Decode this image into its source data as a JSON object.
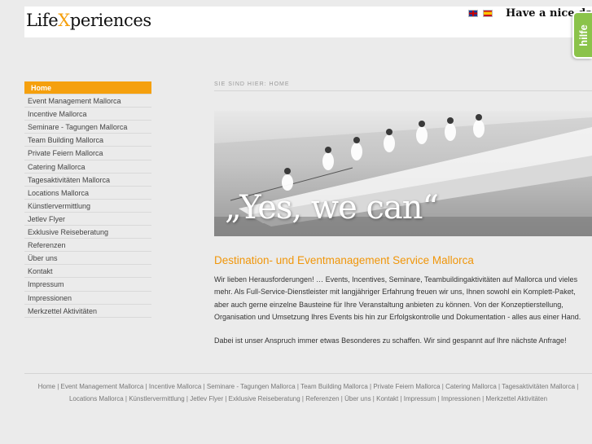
{
  "header": {
    "logo_pre": "Life",
    "logo_x": "X",
    "logo_post": "periences",
    "languages": [
      "English",
      "Español"
    ],
    "greeting": "Have a nice day"
  },
  "help_tab": {
    "label": "hilfe"
  },
  "sidebar": {
    "items": [
      "Home",
      "Event Management Mallorca",
      "Incentive Mallorca",
      "Seminare - Tagungen Mallorca",
      "Team Building Mallorca",
      "Private Feiern Mallorca",
      "Catering Mallorca",
      "Tagesaktivitäten Mallorca",
      "Locations Mallorca",
      "Künstlervermittlung",
      "Jetlev Flyer",
      "Exklusive Reiseberatung",
      "Referenzen",
      "Über uns",
      "Kontakt",
      "Impressum",
      "Impressionen",
      "Merkzettel Aktivitäten"
    ],
    "active_index": 0
  },
  "breadcrumb": {
    "label": "Sie sind hier:",
    "current": "Home"
  },
  "hero": {
    "text": "„Yes, we can“"
  },
  "content": {
    "title": "Destination- und Eventmanagement Service Mallorca",
    "paragraph1": "Wir lieben Herausforderungen! … Events, Incentives, Seminare, Teambuildingaktivitäten auf Mallorca und vieles mehr. Als Full-Service-Dienstleister mit langjähriger Erfahrung freuen wir uns, Ihnen sowohl ein Komplett-Paket, aber auch gerne einzelne Bausteine für Ihre Veranstaltung anbieten zu können. Von der Konzeptierstellung, Organisation und Umsetzung Ihres Events bis hin zur Erfolgskontrolle und Dokumentation - alles aus einer Hand.",
    "paragraph2": "Dabei ist unser Anspruch immer etwas Besonderes zu schaffen. Wir sind gespannt auf Ihre nächste Anfrage!"
  },
  "footer": {
    "links": [
      "Home",
      "Event Management Mallorca",
      "Incentive Mallorca",
      "Seminare - Tagungen Mallorca",
      "Team Building Mallorca",
      "Private Feiern Mallorca",
      "Catering Mallorca",
      "Tagesaktivitäten Mallorca",
      "Locations Mallorca",
      "Künstlervermittlung",
      "Jetlev Flyer",
      "Exklusive Reiseberatung",
      "Referenzen",
      "Über uns",
      "Kontakt",
      "Impressum",
      "Impressionen",
      "Merkzettel Aktivitäten"
    ]
  },
  "colors": {
    "accent": "#f5a00e",
    "help_tab": "#8bc34a",
    "background": "#ebebeb"
  }
}
